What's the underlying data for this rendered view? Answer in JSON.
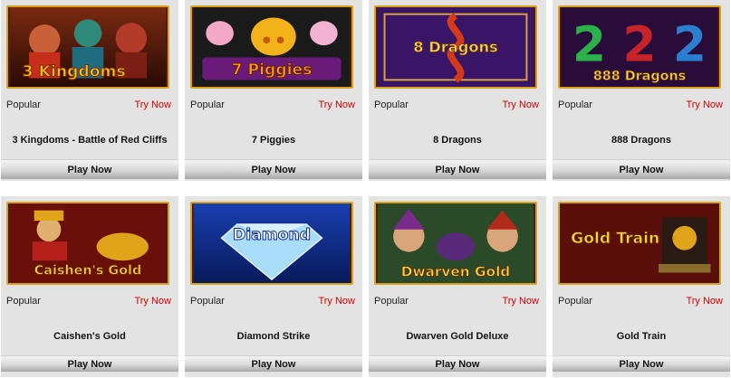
{
  "games": [
    {
      "tag": "Popular",
      "try_label": "Try Now",
      "title": "3 Kingdoms - Battle of Red Cliffs",
      "play_label": "Play Now",
      "logo": "3 Kingdoms",
      "logo_color": "#f7c21a"
    },
    {
      "tag": "Popular",
      "try_label": "Try Now",
      "title": "7 Piggies",
      "play_label": "Play Now",
      "logo": "7 Piggies",
      "logo_color": "#f7a11a"
    },
    {
      "tag": "Popular",
      "try_label": "Try Now",
      "title": "8 Dragons",
      "play_label": "Play Now",
      "logo": "8 Dragons",
      "logo_color": "#f5d35a"
    },
    {
      "tag": "Popular",
      "try_label": "Try Now",
      "title": "888 Dragons",
      "play_label": "Play Now",
      "logo": "888 Dragons",
      "logo_color": "#f5d35a"
    },
    {
      "tag": "Popular",
      "try_label": "Try Now",
      "title": "Caishen's Gold",
      "play_label": "Play Now",
      "logo": "Caishen's Gold",
      "logo_color": "#ffd23a"
    },
    {
      "tag": "Popular",
      "try_label": "Try Now",
      "title": "Diamond Strike",
      "play_label": "Play Now",
      "logo": "Diamond",
      "logo_color": "#ffffff"
    },
    {
      "tag": "Popular",
      "try_label": "Try Now",
      "title": "Dwarven Gold Deluxe",
      "play_label": "Play Now",
      "logo": "Dwarven Gold",
      "logo_color": "#ffd23a"
    },
    {
      "tag": "Popular",
      "try_label": "Try Now",
      "title": "Gold Train",
      "play_label": "Play Now",
      "logo": "Gold Train",
      "logo_color": "#ffd23a"
    }
  ],
  "colors": {
    "try_now": "#d10000",
    "card_bg": "#e3e3e3",
    "thumb_border": "#d9a21b"
  }
}
